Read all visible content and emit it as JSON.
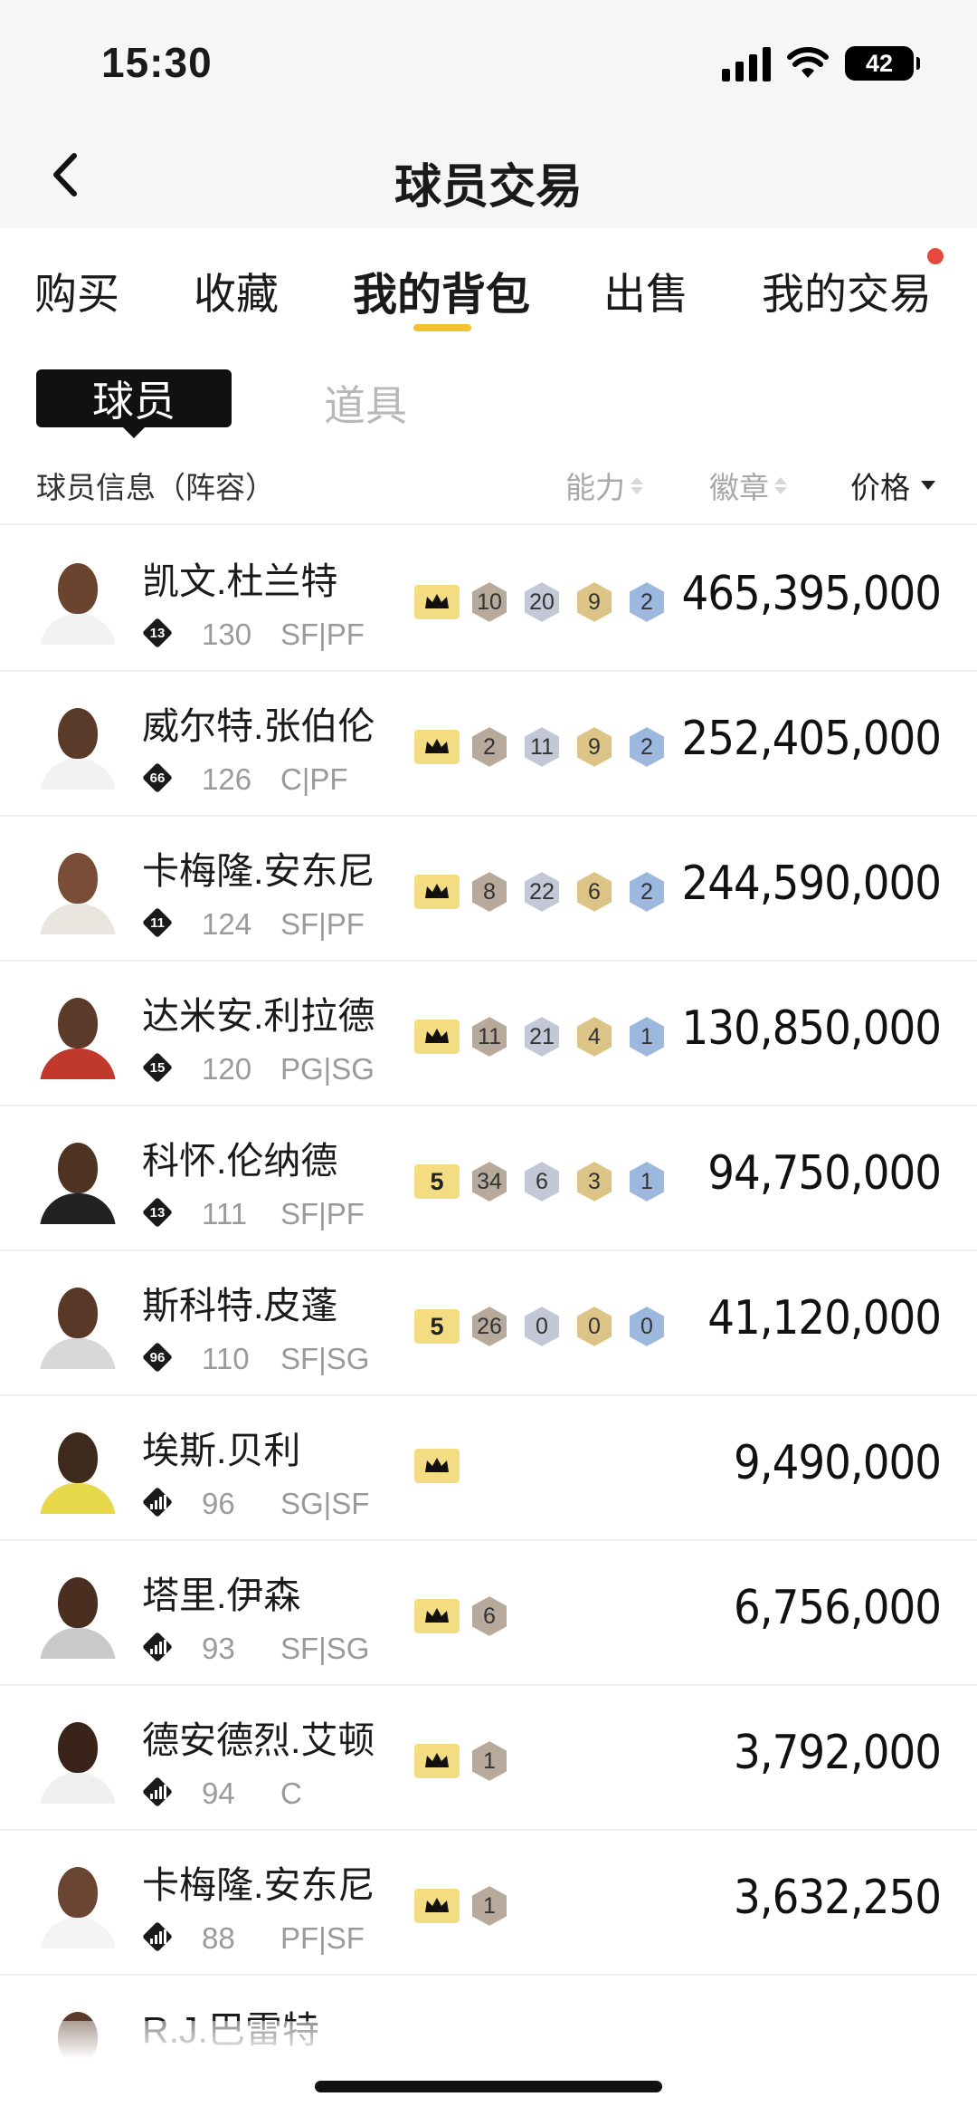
{
  "status": {
    "time": "15:30",
    "battery": "42"
  },
  "nav": {
    "title": "球员交易"
  },
  "tabs": [
    {
      "label": "购买",
      "active": false
    },
    {
      "label": "收藏",
      "active": false
    },
    {
      "label": "我的背包",
      "active": true
    },
    {
      "label": "出售",
      "active": false
    },
    {
      "label": "我的交易",
      "active": false,
      "notification": true
    }
  ],
  "segment": {
    "active": "球员",
    "inactive": "道具"
  },
  "columns": {
    "info": "球员信息（阵容）",
    "ability": "能力",
    "badges": "徽章",
    "price": "价格"
  },
  "colors": {
    "accent": "#f2c230",
    "notification": "#e5483d",
    "badge_bronze": "#b8a99d",
    "badge_silver": "#c3c7d6",
    "badge_gold": "#dcc487",
    "badge_blue": "#9db8de"
  },
  "players": [
    {
      "name": "凯文.杜兰特",
      "tier": "13",
      "rating": "130",
      "pos": "SF|PF",
      "crown": "",
      "badges": [
        "10",
        "20",
        "9",
        "2"
      ],
      "price": "465,395,000"
    },
    {
      "name": "威尔特.张伯伦",
      "tier": "66",
      "rating": "126",
      "pos": "C|PF",
      "crown": "",
      "badges": [
        "2",
        "11",
        "9",
        "2"
      ],
      "price": "252,405,000"
    },
    {
      "name": "卡梅隆.安东尼",
      "tier": "11",
      "rating": "124",
      "pos": "SF|PF",
      "crown": "",
      "badges": [
        "8",
        "22",
        "6",
        "2"
      ],
      "price": "244,590,000"
    },
    {
      "name": "达米安.利拉德",
      "tier": "15",
      "rating": "120",
      "pos": "PG|SG",
      "crown": "",
      "badges": [
        "11",
        "21",
        "4",
        "1"
      ],
      "price": "130,850,000"
    },
    {
      "name": "科怀.伦纳德",
      "tier": "13",
      "rating": "111",
      "pos": "SF|PF",
      "crown": "5",
      "badges": [
        "34",
        "6",
        "3",
        "1"
      ],
      "price": "94,750,000"
    },
    {
      "name": "斯科特.皮蓬",
      "tier": "96",
      "rating": "110",
      "pos": "SF|SG",
      "crown": "5",
      "badges": [
        "26",
        "0",
        "0",
        "0"
      ],
      "price": "41,120,000"
    },
    {
      "name": "埃斯.贝利",
      "tier": "bars",
      "rating": "96",
      "pos": "SG|SF",
      "crown": "",
      "badges": [],
      "price": "9,490,000"
    },
    {
      "name": "塔里.伊森",
      "tier": "bars",
      "rating": "93",
      "pos": "SF|SG",
      "crown": "",
      "badges": [
        "6"
      ],
      "price": "6,756,000"
    },
    {
      "name": "德安德烈.艾顿",
      "tier": "bars",
      "rating": "94",
      "pos": "C",
      "crown": "",
      "badges": [
        "1"
      ],
      "price": "3,792,000"
    },
    {
      "name": "卡梅隆.安东尼",
      "tier": "bars",
      "rating": "88",
      "pos": "PF|SF",
      "crown": "",
      "badges": [
        "1"
      ],
      "price": "3,632,250"
    },
    {
      "name": "R.J.巴雷特",
      "tier": "",
      "rating": "",
      "pos": "",
      "crown": "",
      "badges": [],
      "price": ""
    }
  ]
}
